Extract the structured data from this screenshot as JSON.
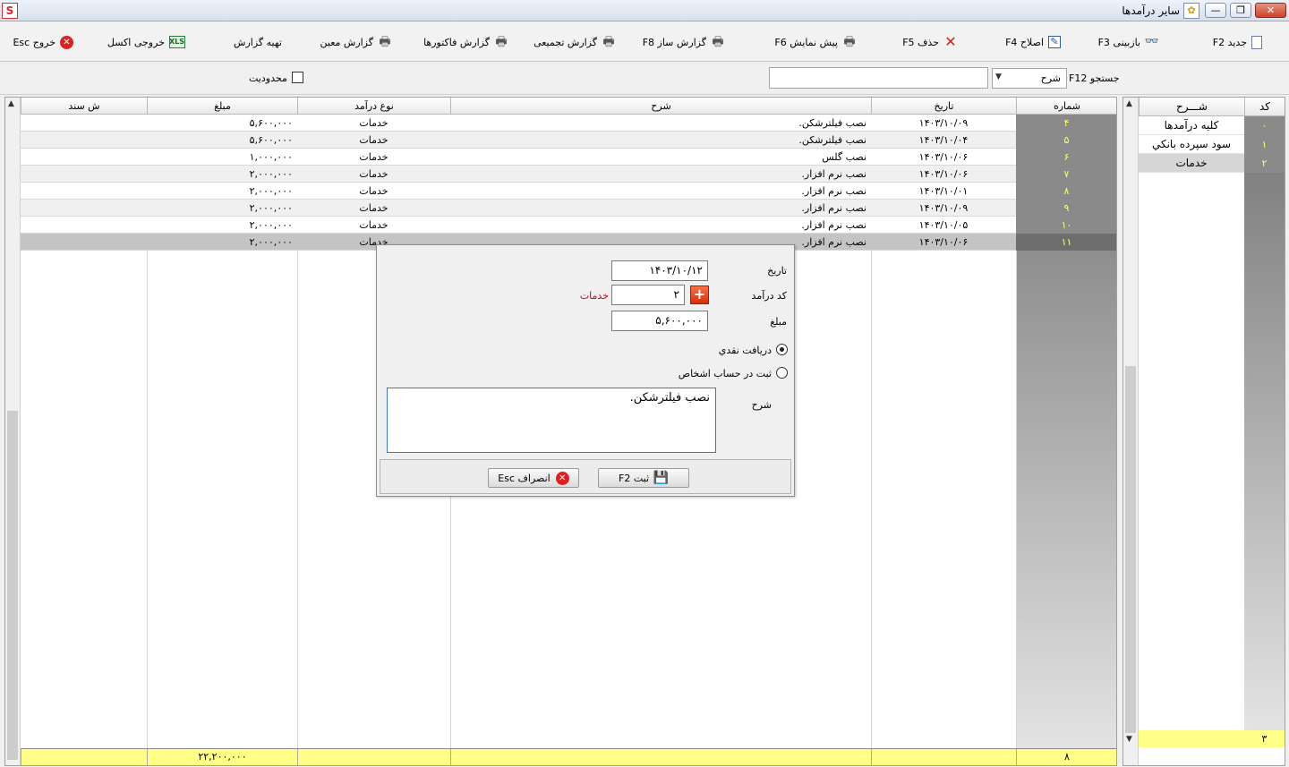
{
  "window": {
    "title": "سایر درآمدها",
    "min": "—",
    "max": "❐",
    "close": "✕",
    "app_logo": "S"
  },
  "toolbar": {
    "new": "جدید  F2",
    "review": "بازبینی F3",
    "edit": "اصلاح F4",
    "delete": "حذف  F5",
    "preview": "پیش نمایش F6",
    "report_builder": "گزارش ساز F8",
    "summary_report": "گزارش تجمیعی",
    "invoice_report": "گزارش فاکتورها",
    "ledger_report": "گزارش معین",
    "prepare_report": "تهیه گزارش",
    "excel": "خروجی اکسل",
    "excel_icon_text": "XLS",
    "exit": "خروج Esc"
  },
  "filter": {
    "search_label": "جستجو F12",
    "search_field_selected": "شرح",
    "search_value": "",
    "limit_label": "محدودیت",
    "limit_checked": false
  },
  "grid": {
    "columns": {
      "number": "شماره",
      "date": "تاریخ",
      "description": "شرح",
      "income_type": "نوع درآمد",
      "amount": "مبلغ",
      "doc_no": "ش سند"
    },
    "rows": [
      {
        "number": "۴",
        "date": "۱۴۰۳/۱۰/۰۹",
        "description": "نصب فیلترشکن.",
        "income_type": "خدمات",
        "amount": "۵,۶۰۰,۰۰۰",
        "doc_no": ""
      },
      {
        "number": "۵",
        "date": "۱۴۰۳/۱۰/۰۴",
        "description": "نصب فیلترشکن.",
        "income_type": "خدمات",
        "amount": "۵,۶۰۰,۰۰۰",
        "doc_no": ""
      },
      {
        "number": "۶",
        "date": "۱۴۰۳/۱۰/۰۶",
        "description": "نصب گلس",
        "income_type": "خدمات",
        "amount": "۱,۰۰۰,۰۰۰",
        "doc_no": ""
      },
      {
        "number": "۷",
        "date": "۱۴۰۳/۱۰/۰۶",
        "description": "نصب نرم افزار.",
        "income_type": "خدمات",
        "amount": "۲,۰۰۰,۰۰۰",
        "doc_no": ""
      },
      {
        "number": "۸",
        "date": "۱۴۰۳/۱۰/۰۱",
        "description": "نصب نرم افزار.",
        "income_type": "خدمات",
        "amount": "۲,۰۰۰,۰۰۰",
        "doc_no": ""
      },
      {
        "number": "۹",
        "date": "۱۴۰۳/۱۰/۰۹",
        "description": "نصب نرم افزار.",
        "income_type": "خدمات",
        "amount": "۲,۰۰۰,۰۰۰",
        "doc_no": ""
      },
      {
        "number": "۱۰",
        "date": "۱۴۰۳/۱۰/۰۵",
        "description": "نصب نرم افزار.",
        "income_type": "خدمات",
        "amount": "۲,۰۰۰,۰۰۰",
        "doc_no": ""
      },
      {
        "number": "۱۱",
        "date": "۱۴۰۳/۱۰/۰۶",
        "description": "نصب نرم افزار.",
        "income_type": "خدمات",
        "amount": "۲,۰۰۰,۰۰۰",
        "doc_no": ""
      }
    ],
    "selected_row": 7,
    "footer": {
      "count": "۸",
      "total_amount": "۲۲,۲۰۰,۰۰۰"
    }
  },
  "side_panel": {
    "columns": {
      "code": "کد",
      "description": "شـــرح"
    },
    "rows": [
      {
        "code": "۰",
        "description": "کلیه درآمدها"
      },
      {
        "code": "۱",
        "description": "سود سپرده بانكي"
      },
      {
        "code": "۲",
        "description": "خدمات"
      }
    ],
    "selected_row": 2,
    "footer_count": "۳"
  },
  "dialog": {
    "date_label": "تاریخ",
    "date_value": "۱۴۰۳/۱۰/۱۲",
    "income_code_label": "کد درآمد",
    "income_code_value": "۲",
    "income_code_name": "خدمات",
    "add_button_label": "+",
    "amount_label": "مبلغ",
    "amount_value": "۵,۶۰۰,۰۰۰",
    "cash_option": "دریافت نقدي",
    "person_option": "ثبت در حساب اشخاص",
    "selected_option": "cash",
    "description_label": "شرح",
    "description_value": "نصب فیلترشکن.",
    "save_button": "ثبت  F2",
    "cancel_button": "انصراف  Esc"
  },
  "icons": [
    "document-icon",
    "glasses-icon",
    "edit-icon",
    "delete-x-icon",
    "printer-icon",
    "excel-icon",
    "exit-icon",
    "save-icon",
    "plus-icon",
    "app-logo-icon",
    "chevron-down-icon"
  ],
  "colors": {
    "row_number_bg": "#8a8a8a",
    "row_number_text": "#ffff6a",
    "footer_bg": "#ffff88",
    "accent_red": "#d32f0f",
    "textarea_border": "#3a78c8"
  }
}
